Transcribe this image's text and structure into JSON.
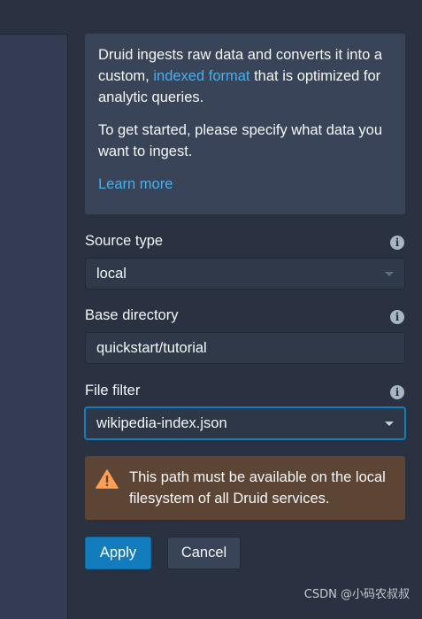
{
  "info": {
    "text_before_link": "Druid ingests raw data and converts it into a custom, ",
    "link_text": "indexed format",
    "text_after_link": " that is optimized for analytic queries.",
    "paragraph2": "To get started, please specify what data you want to ingest.",
    "learn_more": "Learn more"
  },
  "source_type": {
    "label": "Source type",
    "value": "local"
  },
  "base_directory": {
    "label": "Base directory",
    "value": "quickstart/tutorial"
  },
  "file_filter": {
    "label": "File filter",
    "value": "wikipedia-index.json"
  },
  "info_icon_glyph": "i",
  "warning": {
    "text": "This path must be available on the local filesystem of all Druid services."
  },
  "buttons": {
    "apply": "Apply",
    "cancel": "Cancel"
  },
  "watermark": "CSDN @小码农叔叔",
  "colors": {
    "primary": "#137cbd",
    "link": "#48aff0",
    "warning_bg": "#5c4535",
    "warning_icon": "#ff9d54"
  }
}
